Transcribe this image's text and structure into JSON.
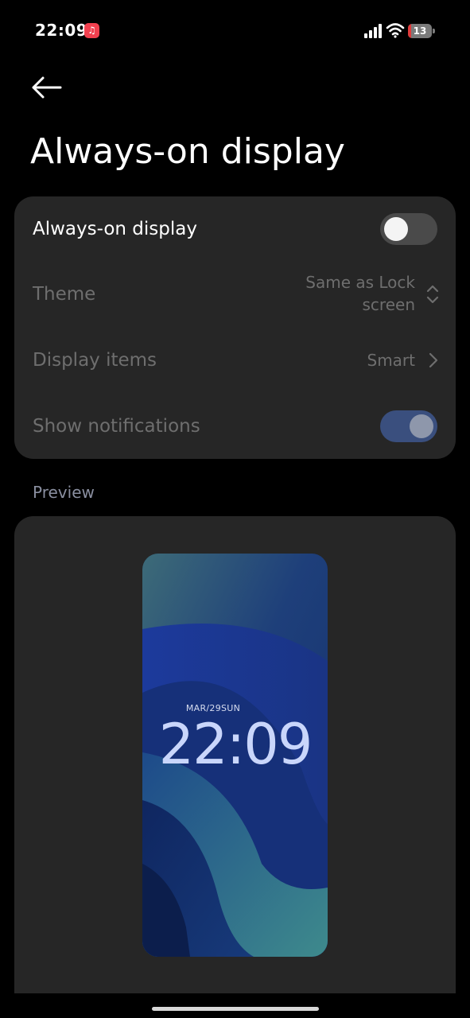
{
  "status_bar": {
    "time": "22:09",
    "notification_icon": "music-icon",
    "battery_level": "13",
    "battery_fraction": 0.13,
    "colors": {
      "music_badge": "#f2404f",
      "battery_low": "#e03a3a"
    }
  },
  "header": {
    "back_icon": "arrow-left-icon",
    "title": "Always-on display"
  },
  "settings": {
    "aod": {
      "label": "Always-on display",
      "enabled": false
    },
    "theme": {
      "label": "Theme",
      "value": "Same as Lock screen",
      "icon": "chevron-updown-icon"
    },
    "display_items": {
      "label": "Display items",
      "value": "Smart",
      "icon": "chevron-right-icon"
    },
    "notifications": {
      "label": "Show notifications",
      "enabled": true,
      "disabled_state": true
    }
  },
  "preview": {
    "label": "Preview",
    "date": "MAR/29SUN",
    "time": "22:09"
  },
  "colors": {
    "background": "#000000",
    "card": "#262626",
    "text_primary": "#ffffff",
    "text_dim": "#6e6e6e",
    "toggle_on": "#3a4f7e",
    "preview_clock": "#c9d6fb"
  }
}
